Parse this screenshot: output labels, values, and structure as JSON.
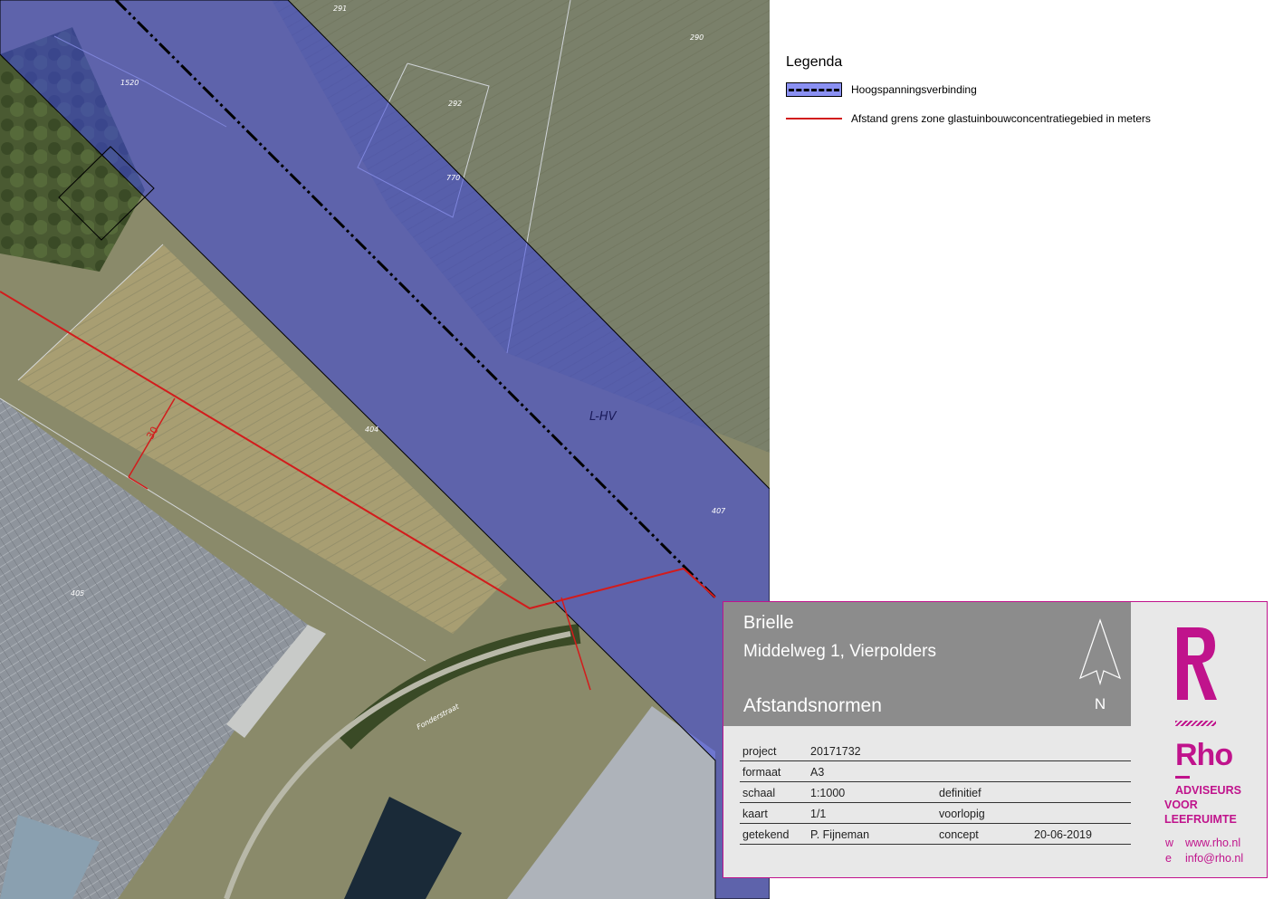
{
  "map": {
    "parcels": [
      "291",
      "290",
      "1520",
      "292",
      "770",
      "404",
      "407",
      "405",
      "Fonderstraat"
    ],
    "zone_label": "L-HV",
    "distance_label": "30"
  },
  "legend": {
    "title": "Legenda",
    "items": [
      {
        "label": "Hoogspanningsverbinding",
        "symbol": "hv"
      },
      {
        "label": "Afstand grens zone glastuinbouwconcentratiegebied in meters",
        "symbol": "red-line"
      }
    ]
  },
  "titleblock": {
    "place": "Brielle",
    "address": "Middelweg 1, Vierpolders",
    "subject": "Afstandsnormen",
    "north": "N",
    "rows": [
      {
        "k": "project",
        "v": "20171732",
        "s": "",
        "d": ""
      },
      {
        "k": "formaat",
        "v": "A3",
        "s": "",
        "d": ""
      },
      {
        "k": "schaal",
        "v": "1:1000",
        "s": "definitief",
        "d": ""
      },
      {
        "k": "kaart",
        "v": "1/1",
        "s": "voorlopig",
        "d": ""
      },
      {
        "k": "getekend",
        "v": "P. Fijneman",
        "s": "concept",
        "d": "20-06-2019"
      }
    ]
  },
  "brand": {
    "letter": "R",
    "name": "Rho",
    "tagline": [
      "ADVISEURS",
      "VOOR",
      "LEEFRUIMTE"
    ],
    "web_key": "w",
    "web": "www.rho.nl",
    "mail_key": "e",
    "mail": "info@rho.nl"
  },
  "colors": {
    "zone": "#3a44e0",
    "red": "#d21c1c",
    "brand": "#c0138c"
  }
}
